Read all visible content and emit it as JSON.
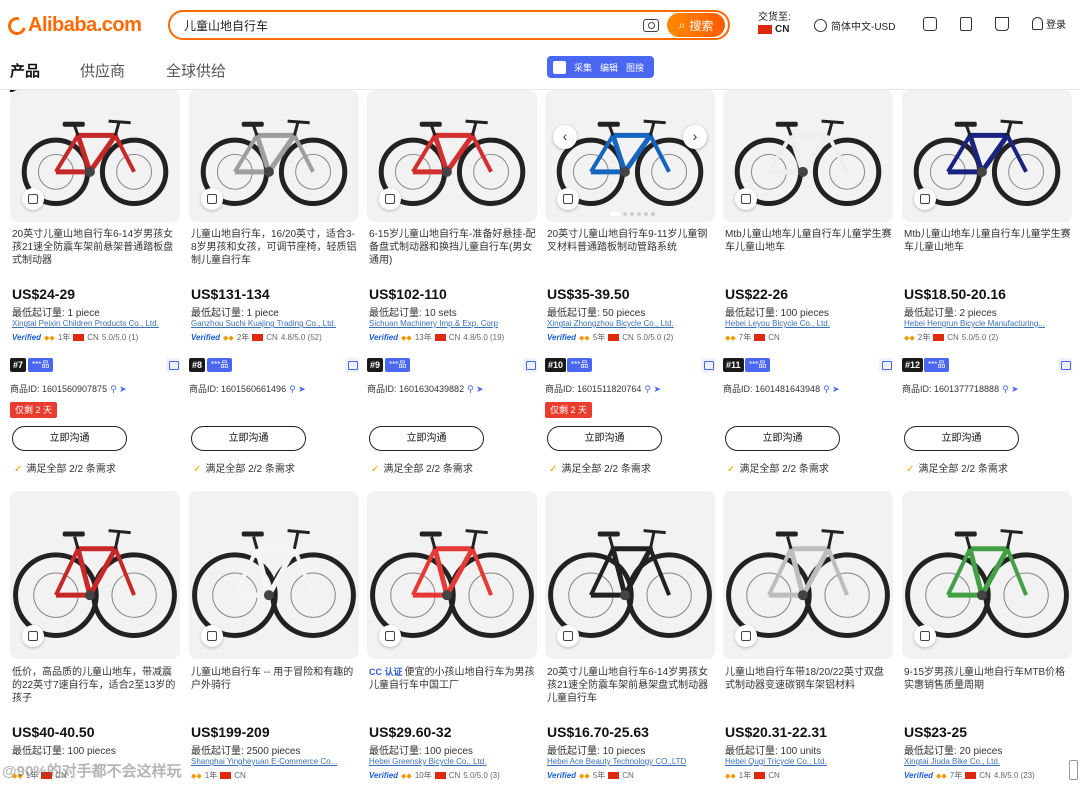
{
  "header": {
    "logo": "Alibaba.com",
    "search_query": "儿童山地自行车",
    "search_button": "搜索",
    "ship_to_label": "交货至:",
    "ship_to_country": "CN",
    "language": "简体中文-USD",
    "login": "登录"
  },
  "tabs": [
    "产品",
    "供应商",
    "全球供给"
  ],
  "plugin": {
    "items": [
      "采集",
      "编辑",
      "图搜"
    ]
  },
  "colors": {
    "accent": "#ff6a00",
    "plugin_blue": "#4a67f2",
    "promo_red": "#e83c2e"
  },
  "row1": [
    {
      "title": "20英寸儿童山地自行车6-14岁男孩女孩21速全防震车架前悬架普通踏板盘式制动器",
      "price": "US$24-29",
      "moq": "最低起订量: 1 piece",
      "supplier": "Xingtai Peixin Children Products Co., Ltd.",
      "verified": "Verified",
      "years": "1年",
      "country": "CN",
      "rating": "5.0/5.0 (1)",
      "rank": "#7",
      "star": "***品",
      "pid": "商品ID: 1601560907875",
      "promo": "仅剩 2 天",
      "chat": "立即沟通",
      "match": "满足全部 2/2 条需求",
      "frame_color": "#c62828"
    },
    {
      "title": "儿童山地自行车，16/20英寸，适合3-8岁男孩和女孩，可调节座椅，轻质铝制儿童自行车",
      "price": "US$131-134",
      "moq": "最低起订量: 1 piece",
      "supplier": "Ganzhou Suchi Kuajing Trading Co., Ltd.",
      "verified": "Verified",
      "years": "2年",
      "country": "CN",
      "rating": "4.8/5.0 (52)",
      "rank": "#8",
      "star": "***品",
      "pid": "商品ID: 1601560661496",
      "promo": "",
      "chat": "立即沟通",
      "match": "满足全部 2/2 条需求",
      "frame_color": "#9e9e9e"
    },
    {
      "title": "6-15岁儿童山地自行车-准备好悬挂-配备盘式制动器和换挡儿童自行车(男女通用)",
      "price": "US$102-110",
      "moq": "最低起订量: 10 sets",
      "supplier": "Sichuan Machinery Imp.& Exp. Corp",
      "verified": "Verified",
      "years": "13年",
      "country": "CN",
      "rating": "4.8/5.0 (19)",
      "rank": "#9",
      "star": "***品",
      "pid": "商品ID: 1601630439882",
      "promo": "",
      "chat": "立即沟通",
      "match": "满足全部 2/2 条需求",
      "frame_color": "#d32f2f"
    },
    {
      "title": "20英寸儿童山地自行车9-11岁儿童钢叉材料普通踏板制动管路系统",
      "price": "US$35-39.50",
      "moq": "最低起订量: 50 pieces",
      "supplier": "Xingtai Zhongzhou Bicycle Co., Ltd.",
      "verified": "Verified",
      "years": "5年",
      "country": "CN",
      "rating": "5.0/5.0 (2)",
      "rank": "#10",
      "star": "***品",
      "pid": "商品ID: 1601511820764",
      "promo": "仅剩 2 天",
      "chat": "立即沟通",
      "match": "满足全部 2/2 条需求",
      "frame_color": "#1565c0"
    },
    {
      "title": "Mtb儿童山地车儿童自行车儿童学生赛车儿童山地车",
      "price": "US$22-26",
      "moq": "最低起订量: 100 pieces",
      "supplier": "Hebei Leyou Bicycle Co., Ltd.",
      "verified": "",
      "years": "7年",
      "country": "CN",
      "rating": "",
      "rank": "#11",
      "star": "***品",
      "pid": "商品ID: 1601481643948",
      "promo": "",
      "chat": "立即沟通",
      "match": "满足全部 2/2 条需求",
      "frame_color": "#eeeeee"
    },
    {
      "title": "Mtb儿童山地车儿童自行车儿童学生赛车儿童山地车",
      "price": "US$18.50-20.16",
      "moq": "最低起订量: 2 pieces",
      "supplier": "Hebei Hengrun Bicycle Manufacturing...",
      "verified": "",
      "years": "2年",
      "country": "CN",
      "rating": "5.0/5.0 (2)",
      "rank": "#12",
      "star": "***品",
      "pid": "商品ID: 1601377718888",
      "promo": "",
      "chat": "立即沟通",
      "match": "满足全部 2/2 条需求",
      "frame_color": "#1a237e"
    }
  ],
  "row2": [
    {
      "title": "低价，高品质的儿童山地车，带减震的22英寸7速自行车，适合2至13岁的孩子",
      "cc": "",
      "price": "US$40-40.50",
      "moq": "最低起订量: 100 pieces",
      "supplier": "",
      "verified": "",
      "years": "1年",
      "country": "CN",
      "rating": "",
      "frame_color": "#c62828"
    },
    {
      "title": "儿童山地自行车 -- 用于冒险和有趣的户外骑行",
      "cc": "",
      "price": "US$199-209",
      "moq": "最低起订量: 2500 pieces",
      "supplier": "Shanghai Yingheyuan E-Commerce Co...",
      "verified": "",
      "years": "1年",
      "country": "CN",
      "rating": "",
      "frame_color": "#f5f5f5"
    },
    {
      "title": "便宜的小孩山地自行车为男孩儿童自行车中国工厂",
      "cc": "CC 认证",
      "price": "US$29.60-32",
      "moq": "最低起订量: 100 pieces",
      "supplier": "Hebei Greensky Bicycle Co., Ltd.",
      "verified": "Verified",
      "years": "10年",
      "country": "CN",
      "rating": "5.0/5.0 (3)",
      "frame_color": "#e53935"
    },
    {
      "title": "20英寸儿童山地自行车6-14岁男孩女孩21速全防震车架前悬架盘式制动器儿童自行车",
      "cc": "",
      "price": "US$16.70-25.63",
      "moq": "最低起订量: 10 pieces",
      "supplier": "Hebei Ace Beauty Technology CO.,LTD",
      "verified": "Verified",
      "years": "5年",
      "country": "CN",
      "rating": "",
      "frame_color": "#212121"
    },
    {
      "title": "儿童山地自行车带18/20/22英寸双盘式制动器变速碳钢车架铝材料",
      "cc": "",
      "price": "US$20.31-22.31",
      "moq": "最低起订量: 100 units",
      "supplier": "Hebei Qugi Tricycle Co., Ltd.",
      "verified": "",
      "years": "1年",
      "country": "CN",
      "rating": "",
      "frame_color": "#bdbdbd"
    },
    {
      "title": "9-15岁男孩儿童山地自行车MTB价格实惠销售质量周期",
      "cc": "",
      "price": "US$23-25",
      "moq": "最低起订量: 20 pieces",
      "supplier": "Xingtai Jiuda Bike Co., Ltd.",
      "verified": "Verified",
      "years": "7年",
      "country": "CN",
      "rating": "4.8/5.0 (23)",
      "frame_color": "#43a047"
    }
  ],
  "watermark": "@90%的对手都不会这样玩"
}
